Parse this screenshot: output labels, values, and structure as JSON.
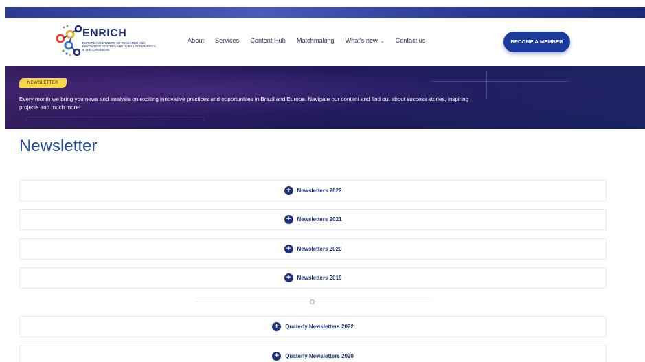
{
  "header": {
    "logo_title": "ENRICH",
    "logo_subtitle": "European Network of Research and Innovation Centres and Hubs Latin America & the Caribbean",
    "menu": [
      {
        "label": "About"
      },
      {
        "label": "Services"
      },
      {
        "label": "Content Hub"
      },
      {
        "label": "Matchmaking"
      },
      {
        "label": "What's new",
        "has_dropdown": true
      },
      {
        "label": "Contact us"
      }
    ],
    "cta_label": "BECOME A MEMBER"
  },
  "hero": {
    "badge": "NEWSLETTER",
    "text": "Every month we bring you news and analysis on exciting innovative practices and opportunities in Brazil and Europe. Navigate our content and find out about success stories, inspiring projects and much more!"
  },
  "page_title": "Newsletter",
  "accordions": [
    {
      "label": "Newsletters 2022"
    },
    {
      "label": "Newsletters 2021"
    },
    {
      "label": "Newsletters 2020"
    },
    {
      "label": "Newsletters 2019"
    }
  ],
  "quarterly_accordions": [
    {
      "label": "Quaterly Newsletters 2022"
    },
    {
      "label": "Quaterly Newsletters 2020"
    }
  ],
  "colors": {
    "brand_blue": "#1a3a9c",
    "title_blue": "#1e4f97",
    "badge_yellow": "#f5d64c",
    "hero_dark": "#141c52"
  },
  "icons": {
    "accordion_toggle": "plus-circle-icon",
    "dropdown": "chevron-down-icon"
  }
}
